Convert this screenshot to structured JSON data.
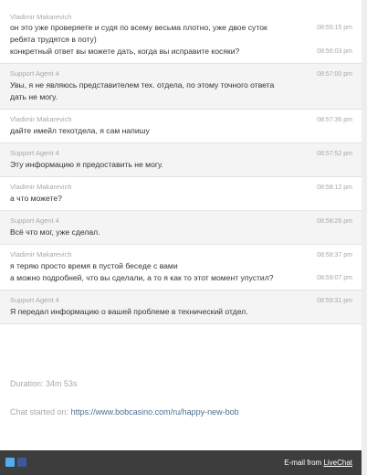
{
  "messages": [
    {
      "role": "visitor",
      "sender": "Vladimir Makarevich",
      "lines": [
        {
          "text": "он это уже проверяете и судя по всему весьма плотно, уже двое суток",
          "time": "08:55:15 pm"
        },
        {
          "text": "ребята трудятся в поту)",
          "time": ""
        },
        {
          "text": "конкретный ответ вы можете дать, когда вы исправите косяки?",
          "time": "08:56:03 pm"
        }
      ]
    },
    {
      "role": "agent",
      "sender": "Support Agent 4",
      "time": "08:57:00 pm",
      "lines": [
        {
          "text": "Увы, я не являюсь представителем тех. отдела, по этому точного ответа",
          "time": ""
        },
        {
          "text": "дать не могу.",
          "time": ""
        }
      ]
    },
    {
      "role": "visitor",
      "sender": "Vladimir Makarevich",
      "time": "08:57:36 pm",
      "lines": [
        {
          "text": "дайте имейл техотдела, я сам напишу",
          "time": ""
        }
      ]
    },
    {
      "role": "agent",
      "sender": "Support Agent 4",
      "time": "08:57:52 pm",
      "lines": [
        {
          "text": "Эту информацию я предоставить не могу.",
          "time": ""
        }
      ]
    },
    {
      "role": "visitor",
      "sender": "Vladimir Makarevich",
      "time": "08:58:12 pm",
      "lines": [
        {
          "text": "а что можете?",
          "time": ""
        }
      ]
    },
    {
      "role": "agent",
      "sender": "Support Agent 4",
      "time": "08:58:26 pm",
      "lines": [
        {
          "text": "Всё что мог, уже сделал.",
          "time": ""
        }
      ]
    },
    {
      "role": "visitor",
      "sender": "Vladimir Makarevich",
      "time": "08:58:37 pm",
      "lines": [
        {
          "text": "я теряю просто время в пустой беседе с вами",
          "time": ""
        },
        {
          "text": "а можно подробней, что вы сделали, а то я как то этот момент упустил?",
          "time": "08:59:07 pm"
        }
      ]
    },
    {
      "role": "agent",
      "sender": "Support Agent 4",
      "time": "08:59:31 pm",
      "lines": [
        {
          "text": "Я передал информацию о вашей проблеме в технический отдел.",
          "time": ""
        }
      ]
    }
  ],
  "summary": {
    "duration_label": "Duration:",
    "duration_value": "34m 53s",
    "started_label": "Chat started on:",
    "started_url": "https://www.bobcasino.com/ru/happy-new-bob"
  },
  "footer": {
    "email_from": "E-mail from",
    "brand": "LiveChat",
    "twitter_icon": "twitter-icon",
    "facebook_icon": "facebook-icon",
    "twitter_color": "#55acee",
    "facebook_color": "#3b5998"
  }
}
